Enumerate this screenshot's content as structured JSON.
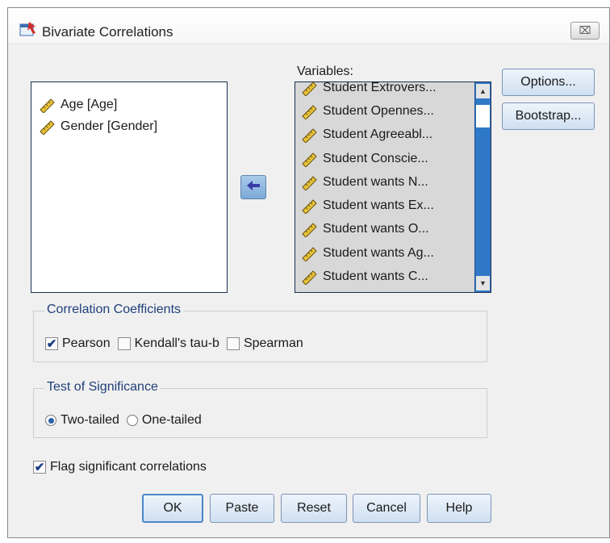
{
  "window": {
    "title": "Bivariate Correlations",
    "close_label": "⌧"
  },
  "source_list": {
    "items": [
      "Age [Age]",
      "Gender [Gender]"
    ]
  },
  "variables": {
    "label": "Variables:",
    "items": [
      "Student Extrovers...",
      "Student Opennes...",
      "Student Agreeabl...",
      "Student Conscie...",
      "Student wants N...",
      "Student wants Ex...",
      "Student wants O...",
      "Student wants Ag...",
      "Student wants C..."
    ]
  },
  "side_buttons": {
    "options": "Options...",
    "bootstrap": "Bootstrap..."
  },
  "correlation": {
    "title": "Correlation Coefficients",
    "pearson": {
      "label": "Pearson",
      "checked": true
    },
    "kendall": {
      "label": "Kendall's tau-b",
      "checked": false
    },
    "spearman": {
      "label": "Spearman",
      "checked": false
    }
  },
  "significance": {
    "title": "Test of Significance",
    "two_tailed": {
      "label": "Two-tailed",
      "selected": true
    },
    "one_tailed": {
      "label": "One-tailed",
      "selected": false
    }
  },
  "flag": {
    "label": "Flag significant correlations",
    "checked": true
  },
  "buttons": {
    "ok": "OK",
    "paste": "Paste",
    "reset": "Reset",
    "cancel": "Cancel",
    "help": "Help"
  },
  "colors": {
    "accent": "#2f78c8",
    "list_border": "#1d2f52",
    "legend_text": "#1f3f7a"
  },
  "icons": {
    "variable": "ruler-icon",
    "move": "arrow-left-icon",
    "app": "spss-dialog-icon"
  }
}
